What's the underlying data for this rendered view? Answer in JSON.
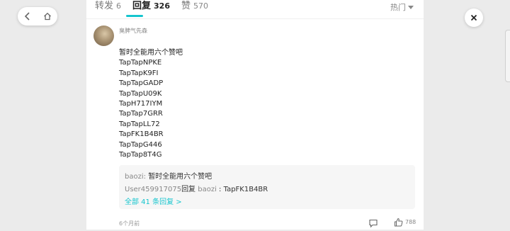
{
  "tabs": [
    {
      "label": "转发",
      "count": "6"
    },
    {
      "label": "回复",
      "count": "326"
    },
    {
      "label": "赞",
      "count": "570"
    }
  ],
  "sort": {
    "label": "热门"
  },
  "comment": {
    "username": "臭脾气先森",
    "lines": [
      "暂时全能用六个赞吧",
      "TapTapNPKE",
      "TapTapK9FI",
      "TapTapGADP",
      "TapTapU09K",
      "TapH717IYM",
      "TapTap7GRR",
      "TapTapLL72",
      "TapFK1B4BR",
      "TapTapG446",
      "TapTap8T4G"
    ],
    "time": "6个月前",
    "likes": "788"
  },
  "replies": {
    "r1_name": "baozi",
    "r1_sep": ": ",
    "r1_text": "暂时全能用六个赞吧",
    "r2_name": "User459917075",
    "r2_label": "回复",
    "r2_target": "baozi",
    "r2_sep": " : ",
    "r2_text": "TapFK1B4BR",
    "more": "全部 41 条回复 >"
  },
  "colors": {
    "accent": "#15c5ce"
  }
}
